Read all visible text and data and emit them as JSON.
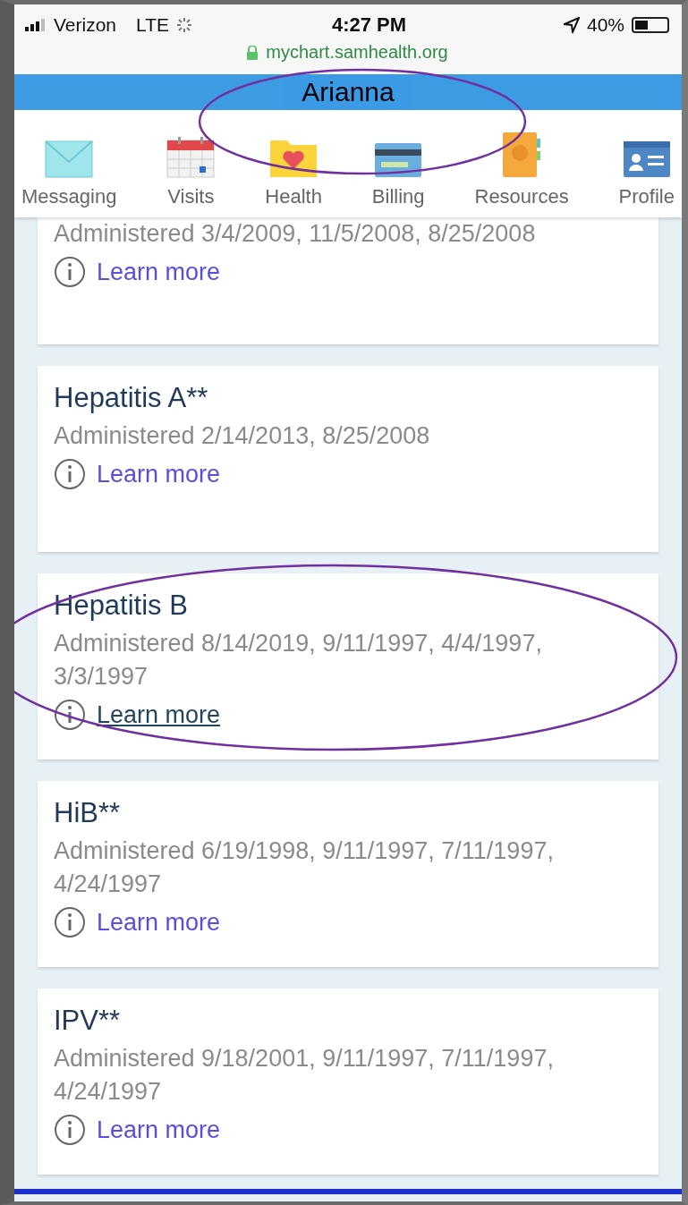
{
  "status_bar": {
    "carrier": "Verizon",
    "network": "LTE",
    "time": "4:27 PM",
    "battery": "40%"
  },
  "url": "mychart.samhealth.org",
  "header": {
    "name": "Arianna"
  },
  "nav": [
    {
      "label": "Messaging",
      "kind": "envelope"
    },
    {
      "label": "Visits",
      "kind": "calendar"
    },
    {
      "label": "Health",
      "kind": "folder"
    },
    {
      "label": "Billing",
      "kind": "card"
    },
    {
      "label": "Resources",
      "kind": "book"
    },
    {
      "label": "Profile",
      "kind": "id"
    }
  ],
  "immunizations": [
    {
      "details": "Administered 3/4/2009, 11/5/2008, 8/25/2008",
      "link": "Learn more",
      "visited": false
    },
    {
      "title": "Hepatitis A**",
      "details": "Administered 2/14/2013, 8/25/2008",
      "link": "Learn more",
      "visited": false
    },
    {
      "title": "Hepatitis B",
      "details": "Administered 8/14/2019, 9/11/1997, 4/4/1997, 3/3/1997",
      "link": "Learn more",
      "visited": true
    },
    {
      "title": "HiB**",
      "details": "Administered 6/19/1998, 9/11/1997, 7/11/1997, 4/24/1997",
      "link": "Learn more",
      "visited": false
    },
    {
      "title": "IPV**",
      "details": "Administered 9/18/2001, 9/11/1997, 7/11/1997, 4/24/1997",
      "link": "Learn more",
      "visited": false
    }
  ]
}
